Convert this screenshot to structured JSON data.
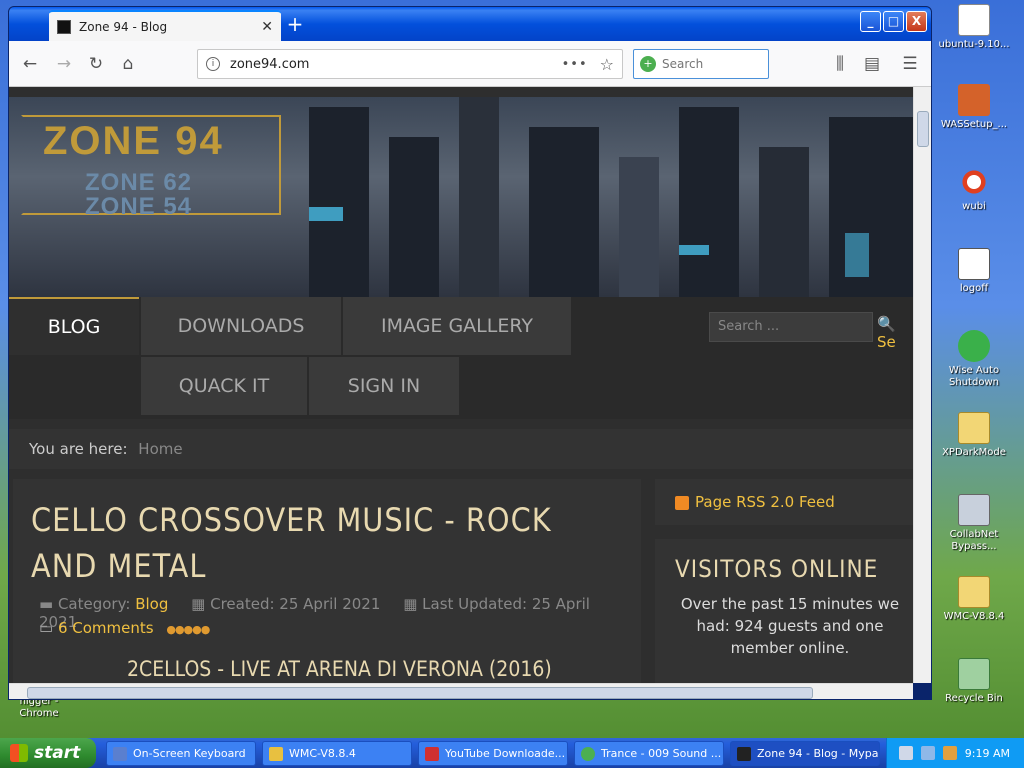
{
  "desktop": {
    "icons": [
      {
        "label": "ubuntu-9.10...",
        "icon": "disc-image-icon"
      },
      {
        "label": "WASSetup_...",
        "icon": "installer-icon"
      },
      {
        "label": "wubi",
        "icon": "ubuntu-icon"
      },
      {
        "label": "logoff",
        "icon": "shortcut-window-icon"
      },
      {
        "label": "Wise Auto Shutdown",
        "icon": "clock-icon"
      },
      {
        "label": "XPDarkMode",
        "icon": "zip-folder-icon"
      },
      {
        "label": "CollabNet Bypass...",
        "icon": "computer-icon"
      },
      {
        "label": "WMC-V8.8.4",
        "icon": "zip-folder-icon"
      },
      {
        "label": "Recycle Bin",
        "icon": "recycle-bin-icon"
      },
      {
        "label": "nigger - Chrome",
        "icon": "chrome-shortcut-icon"
      }
    ]
  },
  "browser": {
    "tab_title": "Zone 94 - Blog",
    "url": "zone94.com",
    "search_placeholder": "Search",
    "window_buttons": [
      "_",
      "□",
      "X"
    ]
  },
  "page": {
    "logo_main": "ZONE 94",
    "logo_sub1": "ZONE 62",
    "logo_sub2": "ZONE 54",
    "menu": [
      "BLOG",
      "DOWNLOADS",
      "IMAGE GALLERY",
      "QUACK IT",
      "SIGN IN"
    ],
    "site_search_placeholder": "Search ...",
    "site_search_btn": "Se",
    "breadcrumb_label": "You are here:",
    "breadcrumb_home": "Home",
    "article_title": "CELLO CROSSOVER MUSIC - ROCK AND METAL",
    "category_label": "Category:",
    "category_value": "Blog",
    "created": "Created: 25 April 2021",
    "updated": "Last Updated: 25 April 2021",
    "comments": "6 Comments",
    "video_title": "2CELLOS - LIVE AT ARENA DI VERONA (2016)",
    "rss": "Page RSS 2.0 Feed",
    "visitors_title": "VISITORS ONLINE",
    "visitors_text": "Over the past 15 minutes we had: 924 guests and one member online."
  },
  "taskbar": {
    "start": "start",
    "tasks": [
      {
        "label": "On-Screen Keyboard",
        "color": "#5a7fcf"
      },
      {
        "label": "WMC-V8.8.4",
        "color": "#e8c040"
      },
      {
        "label": "YouTube Downloade...",
        "color": "#d03030"
      },
      {
        "label": "Trance - 009 Sound ...",
        "color": "#4caf50"
      },
      {
        "label": "Zone 94 - Blog - Mypal",
        "color": "#222222"
      }
    ],
    "clock": "9:19 AM"
  }
}
